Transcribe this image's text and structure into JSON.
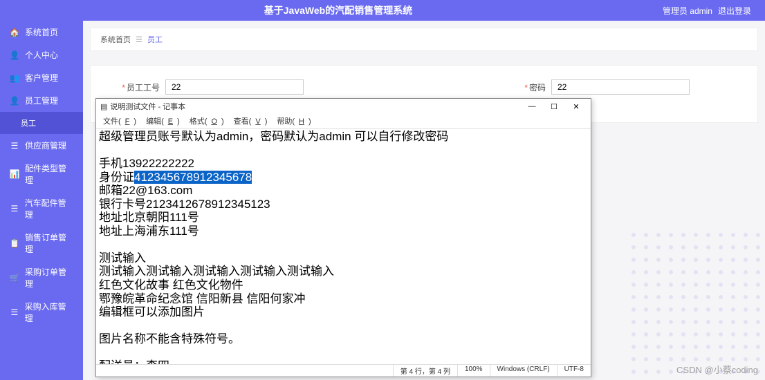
{
  "header": {
    "title": "基于JavaWeb的汽配销售管理系统",
    "user_label": "管理员 admin",
    "logout_label": "退出登录"
  },
  "sidebar": {
    "items": [
      {
        "icon": "🏠",
        "label": "系统首页"
      },
      {
        "icon": "👤",
        "label": "个人中心"
      },
      {
        "icon": "👥",
        "label": "客户管理"
      },
      {
        "icon": "👤",
        "label": "员工管理"
      },
      {
        "icon": "",
        "label": "员工",
        "sub": true,
        "active": true
      },
      {
        "icon": "☰",
        "label": "供应商管理"
      },
      {
        "icon": "📊",
        "label": "配件类型管理"
      },
      {
        "icon": "☰",
        "label": "汽车配件管理"
      },
      {
        "icon": "📋",
        "label": "销售订单管理"
      },
      {
        "icon": "🛒",
        "label": "采购订单管理"
      },
      {
        "icon": "☰",
        "label": "采购入库管理"
      }
    ]
  },
  "breadcrumb": {
    "root": "系统首页",
    "sep": "☰",
    "current": "员工"
  },
  "form": {
    "field1_label": "员工工号",
    "field1_value": "22",
    "field2_label": "密码",
    "field2_value": "22"
  },
  "notepad": {
    "title": "说明测试文件 - 记事本",
    "menu": [
      "文件(F)",
      "编辑(E)",
      "格式(O)",
      "查看(V)",
      "帮助(H)"
    ],
    "lines": {
      "l1": "超级管理员账号默认为admin，密码默认为admin 可以自行修改密码",
      "l2": "",
      "l3": "手机13922222222",
      "l4a": "身份证",
      "l4b_sel": "412345678912345678",
      "l5": "邮箱22@163.com",
      "l6": "银行卡号2123412678912345123",
      "l7": "地址北京朝阳111号",
      "l8": "地址上海浦东111号",
      "l9": "",
      "l10": "测试输入",
      "l11": "测试输入测试输入测试输入测试输入测试输入",
      "l12": "红色文化故事 红色文化物件",
      "l13": "鄂豫皖革命纪念馆 信阳新县 信阳何家冲",
      "l14": "编辑框可以添加图片",
      "l15": "",
      "l16": "图片名称不能含特殊符号。",
      "l17": "",
      "l18": "配送员：李四"
    },
    "status": {
      "pos": "第 4 行，第 4 列",
      "zoom": "100%",
      "crlf": "Windows (CRLF)",
      "enc": "UTF-8"
    }
  },
  "watermark": "CSDN @小蔡coding"
}
